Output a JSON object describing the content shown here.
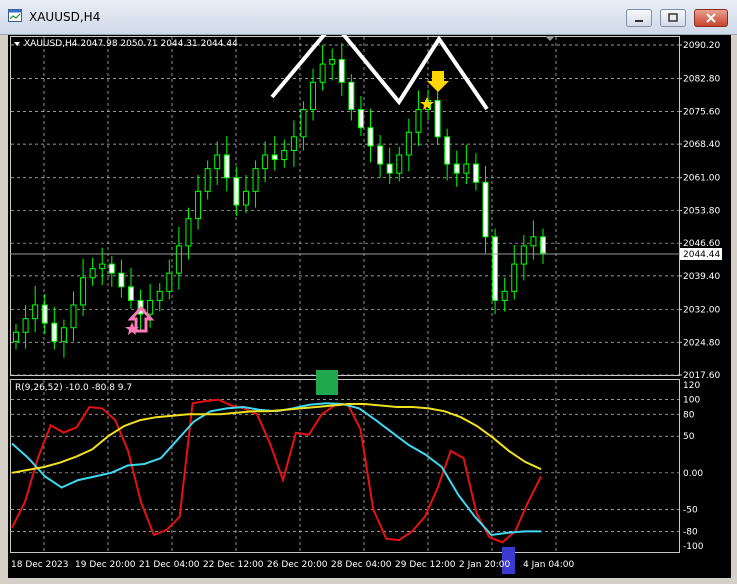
{
  "window": {
    "title": "XAUUSD,H4",
    "icon": "chart-window-icon",
    "controls": [
      "minimize-icon",
      "restore-icon",
      "close-icon"
    ]
  },
  "price_panel": {
    "header": "XAUUSD,H4  2047.98 2050.71 2044.31 2044.44",
    "current_price": "2044.44",
    "price_labels": [
      "2090.20",
      "2082.80",
      "2075.60",
      "2068.40",
      "2061.00",
      "2053.80",
      "2046.60",
      "2039.40",
      "2032.00",
      "2024.80",
      "2017.60"
    ]
  },
  "indicator_panel": {
    "header": "R(9,26,52) -10.0 -80.8 9.7",
    "level_labels": [
      "120",
      "100",
      "80",
      "50",
      "0.00",
      "-50",
      "-80",
      "-100"
    ]
  },
  "time_axis": {
    "labels": [
      "18 Dec 2023",
      "19 Dec 20:00",
      "21 Dec 04:00",
      "22 Dec 12:00",
      "26 Dec 20:00",
      "28 Dec 04:00",
      "29 Dec 12:00",
      "2 Jan 20:00",
      "4 Jan 04:00"
    ]
  },
  "colors": {
    "background": "#000000",
    "bull_candle": "#00ff00",
    "bear_candle": "#ffffff",
    "grid": "#c8c8c8",
    "line_fast": "#e81010",
    "line_mid": "#40d8f0",
    "line_slow": "#f0e020",
    "pattern": "#ffffff",
    "sell_arrow": "#ffd700",
    "buy_arrow": "#ff7ab8",
    "marker_green": "#1fa84e",
    "marker_blue": "#3b3bcf"
  },
  "chart_data": [
    {
      "type": "candlestick",
      "title": "XAUUSD,H4",
      "ylim": [
        2017.6,
        2090.2
      ],
      "y_ticks": [
        2090.2,
        2082.8,
        2075.6,
        2068.4,
        2061.0,
        2053.8,
        2046.6,
        2039.4,
        2032.0,
        2024.8,
        2017.6
      ],
      "x_labels": [
        "18 Dec 2023",
        "19 Dec 20:00",
        "21 Dec 04:00",
        "22 Dec 12:00",
        "26 Dec 20:00",
        "28 Dec 04:00",
        "29 Dec 12:00",
        "2 Jan 20:00",
        "4 Jan 04:00"
      ],
      "close_path": [
        2027,
        2030,
        2033,
        2029,
        2025,
        2028,
        2033,
        2039,
        2041,
        2042,
        2040,
        2037,
        2034,
        2031,
        2034,
        2036,
        2040,
        2046,
        2052,
        2058,
        2063,
        2066,
        2061,
        2055,
        2058,
        2063,
        2066,
        2065,
        2067,
        2070,
        2076,
        2082,
        2086,
        2087,
        2082,
        2076,
        2072,
        2068,
        2064,
        2062,
        2066,
        2071,
        2076,
        2078,
        2070,
        2064,
        2062,
        2064,
        2060,
        2048,
        2034,
        2036,
        2042,
        2046,
        2048,
        2044.44
      ],
      "last": {
        "open": 2047.98,
        "high": 2050.71,
        "low": 2044.31,
        "close": 2044.44
      }
    },
    {
      "type": "line",
      "title": "R(9,26,52)",
      "ylim": [
        -100,
        120
      ],
      "levels": [
        120,
        100,
        80,
        50,
        0,
        -50,
        -80,
        -100
      ],
      "series": [
        {
          "values": [
            -75,
            -40,
            20,
            65,
            55,
            62,
            90,
            88,
            72,
            30,
            -40,
            -85,
            -78,
            -60,
            95,
            98,
            100,
            92,
            88,
            80,
            40,
            -10,
            55,
            52,
            80,
            92,
            94,
            60,
            -50,
            -90,
            -92,
            -80,
            -60,
            -20,
            30,
            20,
            -55,
            -88,
            -95,
            -80,
            -40,
            -5
          ]
        },
        {
          "values": [
            40,
            20,
            -5,
            -20,
            -10,
            -5,
            0,
            10,
            12,
            20,
            45,
            70,
            84,
            88,
            90,
            86,
            84,
            88,
            93,
            95,
            94,
            88,
            72,
            55,
            38,
            25,
            8,
            -30,
            -60,
            -85,
            -82,
            -80,
            -80
          ]
        },
        {
          "values": [
            0,
            4,
            8,
            14,
            22,
            32,
            50,
            64,
            72,
            76,
            78,
            80,
            80,
            80,
            82,
            84,
            84,
            86,
            88,
            90,
            92,
            94,
            94,
            92,
            90,
            90,
            88,
            84,
            76,
            64,
            48,
            30,
            15,
            5
          ]
        }
      ]
    }
  ]
}
